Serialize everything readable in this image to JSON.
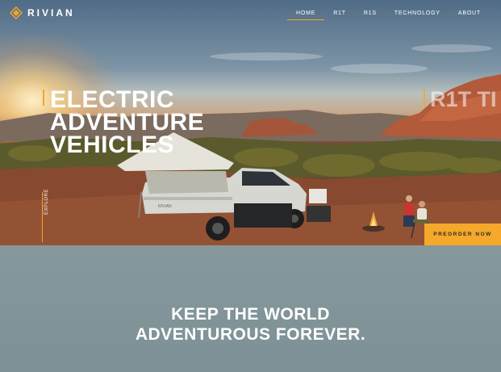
{
  "brand": {
    "name": "RIVIAN",
    "accent": "#f5a623"
  },
  "nav": {
    "items": [
      {
        "label": "HOME",
        "active": true
      },
      {
        "label": "R1T",
        "active": false
      },
      {
        "label": "R1S",
        "active": false
      },
      {
        "label": "TECHNOLOGY",
        "active": false
      },
      {
        "label": "ABOUT",
        "active": false
      }
    ]
  },
  "hero": {
    "headline": [
      "ELECTRIC",
      "ADVENTURE",
      "VEHICLES"
    ],
    "next_slide_label": "R1T TI",
    "explore_label": "EXPLORE",
    "cta_label": "PREORDER NOW",
    "cta_color": "#f5a82a",
    "truck_badge": "RIVIAN"
  },
  "mission": {
    "line1": "KEEP THE WORLD",
    "line2": "ADVENTUROUS FOREVER."
  }
}
